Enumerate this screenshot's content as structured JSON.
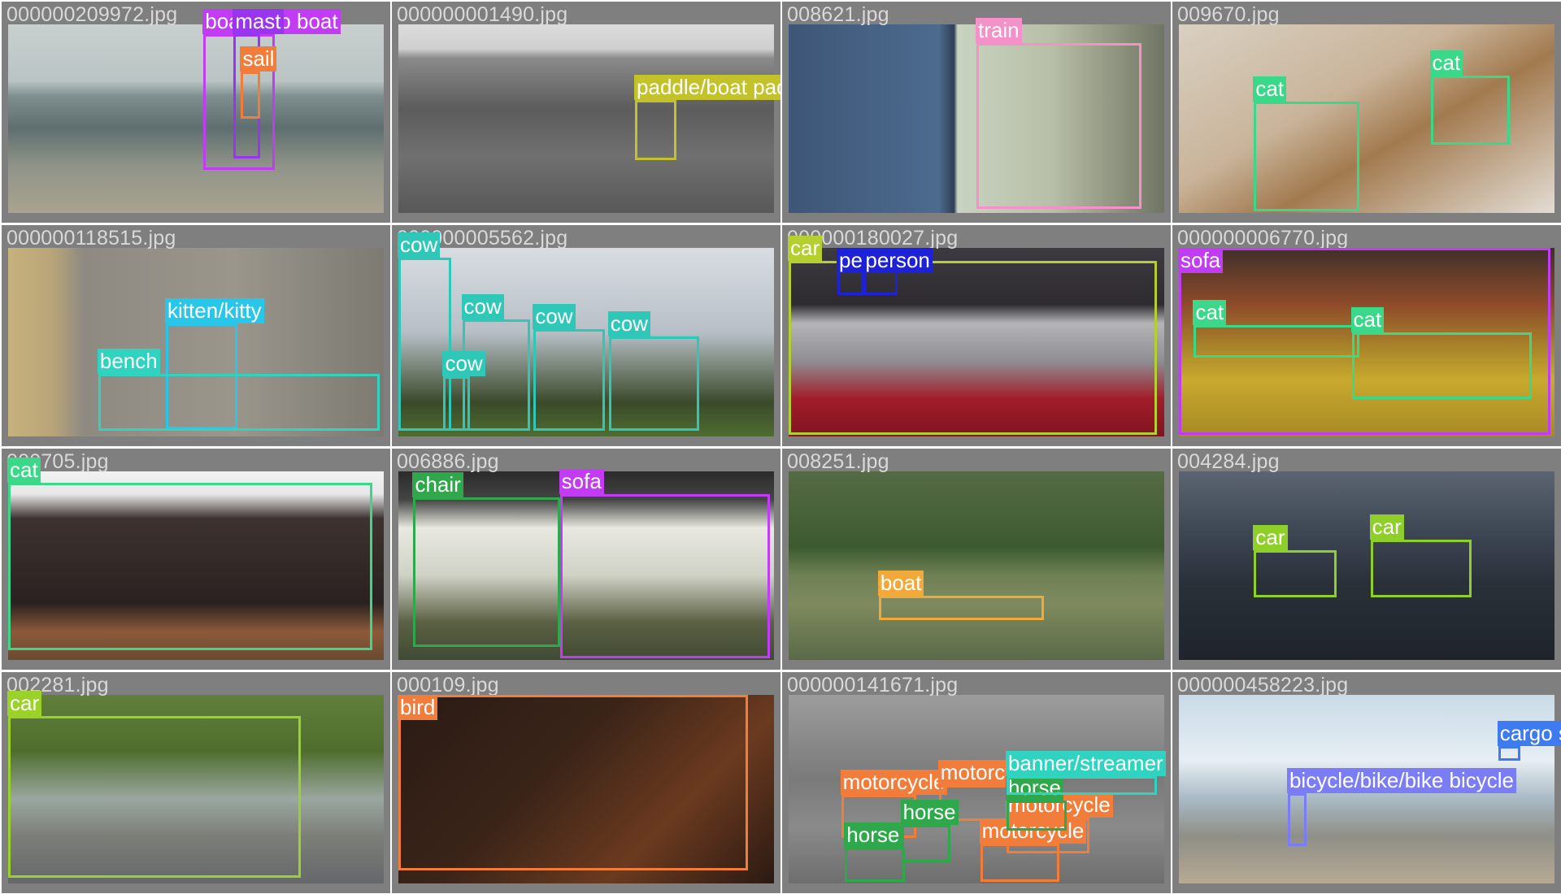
{
  "tiles": [
    {
      "file": "000000209972.jpg",
      "bg": "linear-gradient(#c9d0cf 0%,#b9c4c3 30%,#7f8f8f 38%,#5f6f6f 55%,#8f9489 75%,#a9a38f 100%)",
      "anns": [
        {
          "label": "boat/ship boat",
          "color": "#c23bf5",
          "l": 0.52,
          "t": 0.05,
          "w": 0.19,
          "h": 0.72
        },
        {
          "label": "mast",
          "color": "#9b34f0",
          "l": 0.6,
          "t": 0.05,
          "w": 0.07,
          "h": 0.66
        },
        {
          "label": "sail",
          "color": "#f27d3a",
          "l": 0.62,
          "t": 0.25,
          "w": 0.05,
          "h": 0.25
        }
      ]
    },
    {
      "file": "000000001490.jpg",
      "bg": "linear-gradient(#dcdcdc 0%,#cfcfcf 13%,#8a8a8a 18%,#5c5c5c 45%,#707070 70%,#585858 100%)",
      "anns": [
        {
          "label": "paddle/boat paddle",
          "color": "#c3c22a",
          "l": 0.63,
          "t": 0.4,
          "w": 0.11,
          "h": 0.32
        }
      ]
    },
    {
      "file": "008621.jpg",
      "bg": "linear-gradient(90deg,#3e5677 0%,#4c6b8e 40%,#2e3f55 44%,#c8d3c0 45%,#b8bfa8 70%,#6f7562 100%)",
      "anns": [
        {
          "label": "train",
          "color": "#f391c8",
          "l": 0.5,
          "t": 0.1,
          "w": 0.44,
          "h": 0.88
        }
      ]
    },
    {
      "file": "009670.jpg",
      "bg": "linear-gradient(150deg,#d9d0c2 0%,#c9b49a 40%,#a27a4f 60%,#e3ddd4 100%)",
      "anns": [
        {
          "label": "cat",
          "color": "#3bd88a",
          "l": 0.2,
          "t": 0.41,
          "w": 0.28,
          "h": 0.58
        },
        {
          "label": "cat",
          "color": "#3bd88a",
          "l": 0.67,
          "t": 0.27,
          "w": 0.21,
          "h": 0.37
        }
      ]
    },
    {
      "file": "000000118515.jpg",
      "bg": "linear-gradient(90deg,#c7b27c 0%,#b8a47a 12%,#8e8a81 20%,#9a968c 60%,#7d7a72 100%)",
      "anns": [
        {
          "label": "kitten/kitty",
          "color": "#28c6e9",
          "l": 0.42,
          "t": 0.4,
          "w": 0.19,
          "h": 0.56
        },
        {
          "label": "bench",
          "color": "#2fd3c0",
          "l": 0.24,
          "t": 0.67,
          "w": 0.75,
          "h": 0.3
        }
      ]
    },
    {
      "file": "000000005562.jpg",
      "bg": "linear-gradient(#d8dde2 0%,#b7bfc6 45%,#3a4a2a 82%,#4f6d32 100%)",
      "anns": [
        {
          "label": "cow",
          "color": "#2fc7b8",
          "l": 0.0,
          "t": 0.05,
          "w": 0.14,
          "h": 0.92
        },
        {
          "label": "cow",
          "color": "#2fc7b8",
          "l": 0.17,
          "t": 0.38,
          "w": 0.18,
          "h": 0.59
        },
        {
          "label": "cow",
          "color": "#2fc7b8",
          "l": 0.36,
          "t": 0.43,
          "w": 0.19,
          "h": 0.54
        },
        {
          "label": "cow",
          "color": "#2fc7b8",
          "l": 0.56,
          "t": 0.47,
          "w": 0.24,
          "h": 0.5
        },
        {
          "label": "cow",
          "color": "#2fc7b8",
          "l": 0.12,
          "t": 0.68,
          "w": 0.07,
          "h": 0.29
        }
      ]
    },
    {
      "file": "000000180027.jpg",
      "bg": "linear-gradient(#3c3a40 0%,#2e2b30 30%,#b5b5b8 40%,#8e8e93 60%,#a21d2a 80%,#7f1420 100%)",
      "anns": [
        {
          "label": "car",
          "color": "#b5cf2e",
          "l": 0.0,
          "t": 0.07,
          "w": 0.98,
          "h": 0.92
        },
        {
          "label": "person",
          "color": "#1d22d9",
          "l": 0.13,
          "t": 0.0,
          "w": 0.07,
          "h": 0.25
        },
        {
          "label": "person",
          "color": "#1d22d9",
          "l": 0.2,
          "t": 0.0,
          "w": 0.09,
          "h": 0.25
        }
      ]
    },
    {
      "file": "000000006770.jpg",
      "bg": "linear-gradient(#3f2f2a 0%,#8e4b2a 30%,#b0902a 58%,#c9a92e 70%,#a68925 100%)",
      "anns": [
        {
          "label": "sofa",
          "color": "#c23bf5",
          "l": 0.0,
          "t": 0.0,
          "w": 0.99,
          "h": 0.99
        },
        {
          "label": "cat",
          "color": "#3bd88a",
          "l": 0.04,
          "t": 0.41,
          "w": 0.44,
          "h": 0.17
        },
        {
          "label": "cat",
          "color": "#3bd88a",
          "l": 0.46,
          "t": 0.45,
          "w": 0.48,
          "h": 0.35
        }
      ]
    },
    {
      "file": "000705.jpg",
      "bg": "linear-gradient(#f2f2f2 0%,#e8e8e8 12%,#3d3230 25%,#2a2220 70%,#8c5a3a 85%,#6a4a30 100%)",
      "anns": [
        {
          "label": "cat",
          "color": "#3bd88a",
          "l": 0.0,
          "t": 0.06,
          "w": 0.97,
          "h": 0.89
        }
      ]
    },
    {
      "file": "006886.jpg",
      "bg": "linear-gradient(#2b2b2b 0%,#444 15%,#e8e8e0 30%,#d0d2c6 55%,#5c6144 80%,#404a33 100%)",
      "anns": [
        {
          "label": "chair",
          "color": "#2ea84b",
          "l": 0.04,
          "t": 0.14,
          "w": 0.39,
          "h": 0.79
        },
        {
          "label": "sofa",
          "color": "#c23bf5",
          "l": 0.43,
          "t": 0.12,
          "w": 0.56,
          "h": 0.87
        }
      ]
    },
    {
      "file": "008251.jpg",
      "bg": "linear-gradient(#556b45 0%,#3d5a2f 40%,#6e8055 55%,#7f8a5e 70%,#5a6a48 100%)",
      "anns": [
        {
          "label": "boat",
          "color": "#f2a93b",
          "l": 0.24,
          "t": 0.66,
          "w": 0.44,
          "h": 0.13
        }
      ]
    },
    {
      "file": "004284.jpg",
      "bg": "linear-gradient(#5b6470 0%,#3b4452 35%,#2a3038 60%,#1f242b 100%)",
      "anns": [
        {
          "label": "car",
          "color": "#8fcf2a",
          "l": 0.2,
          "t": 0.42,
          "w": 0.22,
          "h": 0.25
        },
        {
          "label": "car",
          "color": "#8fcf2a",
          "l": 0.51,
          "t": 0.36,
          "w": 0.27,
          "h": 0.31
        }
      ]
    },
    {
      "file": "002281.jpg",
      "bg": "linear-gradient(#5f7f3a 0%,#4f6e2e 30%,#9aa7a0 55%,#7c7f78 75%,#65676a 100%)",
      "anns": [
        {
          "label": "car",
          "color": "#9bd22a",
          "l": 0.0,
          "t": 0.11,
          "w": 0.78,
          "h": 0.86
        }
      ]
    },
    {
      "file": "000109.jpg",
      "bg": "linear-gradient(135deg,#2a1b15 0%,#3a2418 40%,#6b3a1f 70%,#2b1a12 100%)",
      "anns": [
        {
          "label": "bird",
          "color": "#f27d3a",
          "l": 0.0,
          "t": 0.0,
          "w": 0.93,
          "h": 0.93
        }
      ]
    },
    {
      "file": "000000141671.jpg",
      "bg": "linear-gradient(#9c9c9c 0%,#7a7a7a 45%,#8a8a8a 70%,#6e6e6e 100%)",
      "anns": [
        {
          "label": "motorcycle",
          "color": "#f27d3a",
          "l": 0.14,
          "t": 0.53,
          "w": 0.2,
          "h": 0.23
        },
        {
          "label": "motorcycle",
          "color": "#f27d3a",
          "l": 0.4,
          "t": 0.48,
          "w": 0.19,
          "h": 0.19
        },
        {
          "label": "motorcycle",
          "color": "#f27d3a",
          "l": 0.58,
          "t": 0.65,
          "w": 0.22,
          "h": 0.19
        },
        {
          "label": "motorcycle",
          "color": "#f27d3a",
          "l": 0.51,
          "t": 0.79,
          "w": 0.21,
          "h": 0.2
        },
        {
          "label": "horse",
          "color": "#2ea84b",
          "l": 0.3,
          "t": 0.69,
          "w": 0.13,
          "h": 0.2
        },
        {
          "label": "horse",
          "color": "#2ea84b",
          "l": 0.15,
          "t": 0.81,
          "w": 0.16,
          "h": 0.18
        },
        {
          "label": "horse",
          "color": "#2ea84b",
          "l": 0.58,
          "t": 0.56,
          "w": 0.16,
          "h": 0.16
        },
        {
          "label": "banner/streamer",
          "color": "#2fd3c0",
          "l": 0.58,
          "t": 0.43,
          "w": 0.4,
          "h": 0.1
        }
      ]
    },
    {
      "file": "000000458223.jpg",
      "bg": "linear-gradient(#c9dbe8 0%,#e6eef3 35%,#a9bac4 55%,#8e8f87 75%,#b7a994 100%)",
      "anns": [
        {
          "label": "cargo ship",
          "color": "#3e7bf0",
          "l": 0.85,
          "t": 0.27,
          "w": 0.06,
          "h": 0.08
        },
        {
          "label": "bicycle/bike/bike bicycle",
          "color": "#7a7df5",
          "l": 0.29,
          "t": 0.52,
          "w": 0.05,
          "h": 0.28
        }
      ]
    }
  ]
}
